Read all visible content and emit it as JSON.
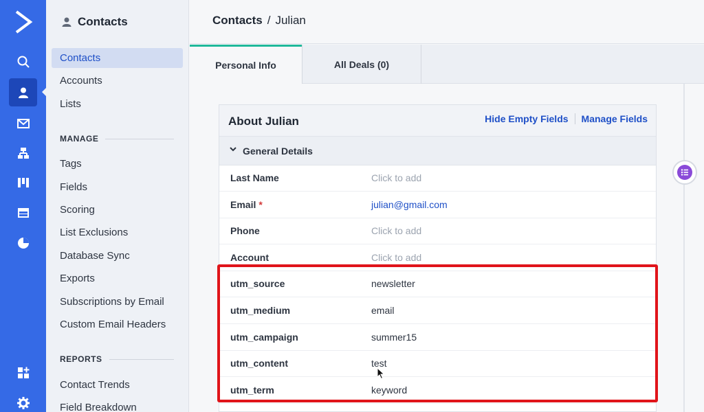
{
  "sidebar": {
    "title": "Contacts",
    "items": [
      {
        "label": "Contacts"
      },
      {
        "label": "Accounts"
      },
      {
        "label": "Lists"
      }
    ],
    "manage_heading": "MANAGE",
    "manage_items": [
      {
        "label": "Tags"
      },
      {
        "label": "Fields"
      },
      {
        "label": "Scoring"
      },
      {
        "label": "List Exclusions"
      },
      {
        "label": "Database Sync"
      },
      {
        "label": "Exports"
      },
      {
        "label": "Subscriptions by Email"
      },
      {
        "label": "Custom Email Headers"
      }
    ],
    "reports_heading": "REPORTS",
    "reports_items": [
      {
        "label": "Contact Trends"
      },
      {
        "label": "Field Breakdown"
      }
    ]
  },
  "rail_icons": [
    "logo-chevron-icon",
    "search-icon",
    "contacts-icon",
    "email-icon",
    "automations-icon",
    "deals-icon",
    "website-icon",
    "reports-icon",
    "apps-icon",
    "settings-icon"
  ],
  "breadcrumb": {
    "root": "Contacts",
    "separator": "/",
    "current": "Julian"
  },
  "tabs": [
    {
      "label": "Personal Info",
      "active": true
    },
    {
      "label": "All Deals (0)",
      "active": false
    }
  ],
  "card": {
    "title": "About Julian",
    "hide_empty": "Hide Empty Fields",
    "manage_fields": "Manage Fields",
    "group": "General Details",
    "fields": [
      {
        "label": "Last Name",
        "value": "Click to add",
        "style": "placeholder",
        "required": ""
      },
      {
        "label": "Email",
        "value": "julian@gmail.com",
        "style": "link",
        "required": "*"
      },
      {
        "label": "Phone",
        "value": "Click to add",
        "style": "placeholder",
        "required": ""
      },
      {
        "label": "Account",
        "value": "Click to add",
        "style": "placeholder",
        "required": ""
      },
      {
        "label": "utm_source",
        "value": "newsletter",
        "style": "normal",
        "required": ""
      },
      {
        "label": "utm_medium",
        "value": "email",
        "style": "normal",
        "required": ""
      },
      {
        "label": "utm_campaign",
        "value": "summer15",
        "style": "normal",
        "required": ""
      },
      {
        "label": "utm_content",
        "value": "test",
        "style": "normal",
        "required": ""
      },
      {
        "label": "utm_term",
        "value": "keyword",
        "style": "normal",
        "required": ""
      }
    ]
  },
  "colors": {
    "rail": "#356ae6",
    "accent": "#1e4fc7",
    "tab_active": "#1fb89a",
    "highlight": "#e0141a",
    "timeline": "#8a4ad8"
  }
}
